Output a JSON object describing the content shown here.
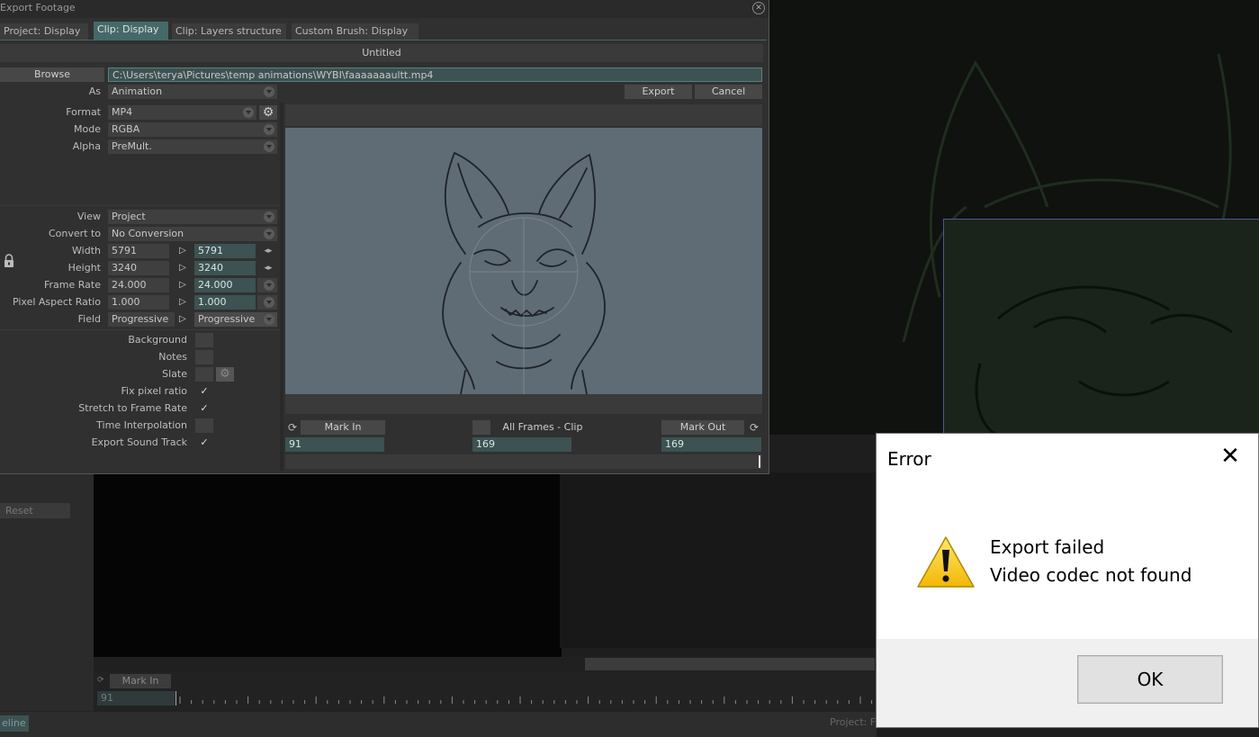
{
  "dialog": {
    "title": "Export Footage",
    "tabs": [
      {
        "label": "Project: Display",
        "active": false
      },
      {
        "label": "Clip: Display",
        "active": true
      },
      {
        "label": "Clip: Layers structure",
        "active": false
      },
      {
        "label": "Custom Brush: Display",
        "active": false
      }
    ],
    "document_name": "Untitled",
    "browse_label": "Browse",
    "path": "C:\\Users\\terya\\Pictures\\temp animations\\WYBI\\faaaaaaaultt.mp4",
    "as_label": "As",
    "as_value": "Animation",
    "export_label": "Export",
    "cancel_label": "Cancel",
    "format_label": "Format",
    "format_value": "MP4",
    "mode_label": "Mode",
    "mode_value": "RGBA",
    "alpha_label": "Alpha",
    "alpha_value": "PreMult.",
    "view_label": "View",
    "view_value": "Project",
    "convert_label": "Convert to",
    "convert_value": "No Conversion",
    "width_label": "Width",
    "width_src": "5791",
    "width_dst": "5791",
    "height_label": "Height",
    "height_src": "3240",
    "height_dst": "3240",
    "framerate_label": "Frame Rate",
    "framerate_src": "24.000",
    "framerate_dst": "24.000",
    "par_label": "Pixel Aspect Ratio",
    "par_src": "1.000",
    "par_dst": "1.000",
    "field_label": "Field",
    "field_src": "Progressive",
    "field_dst": "Progressive",
    "options": {
      "background": {
        "label": "Background",
        "checked": false
      },
      "notes": {
        "label": "Notes",
        "checked": false
      },
      "slate": {
        "label": "Slate",
        "checked": false
      },
      "fix_pixel_ratio": {
        "label": "Fix pixel ratio",
        "checked": true
      },
      "stretch": {
        "label": "Stretch to Frame Rate",
        "checked": true
      },
      "time_interp": {
        "label": "Time Interpolation",
        "checked": false
      },
      "export_sound": {
        "label": "Export Sound Track",
        "checked": true
      }
    },
    "check_glyph": "✓",
    "mark_in_label": "Mark In",
    "mark_in_value": "91",
    "all_frames_label": "All Frames - Clip",
    "all_frames_value": "169",
    "mark_out_label": "Mark Out",
    "mark_out_value": "169"
  },
  "background_app": {
    "reset_label": "Reset",
    "mark_in_label": "Mark In",
    "mark_in_value": "91",
    "timeline_tab": "eline",
    "project_text": "Project: F"
  },
  "error_box": {
    "title": "Error",
    "close_glyph": "✕",
    "line1": "Export failed",
    "line2": "Video codec not found",
    "ok_label": "OK",
    "icon": "warning-icon"
  },
  "colors": {
    "teal_field": "#3d5252",
    "active_tab": "#446969",
    "preview_bg": "#5f6c76"
  }
}
